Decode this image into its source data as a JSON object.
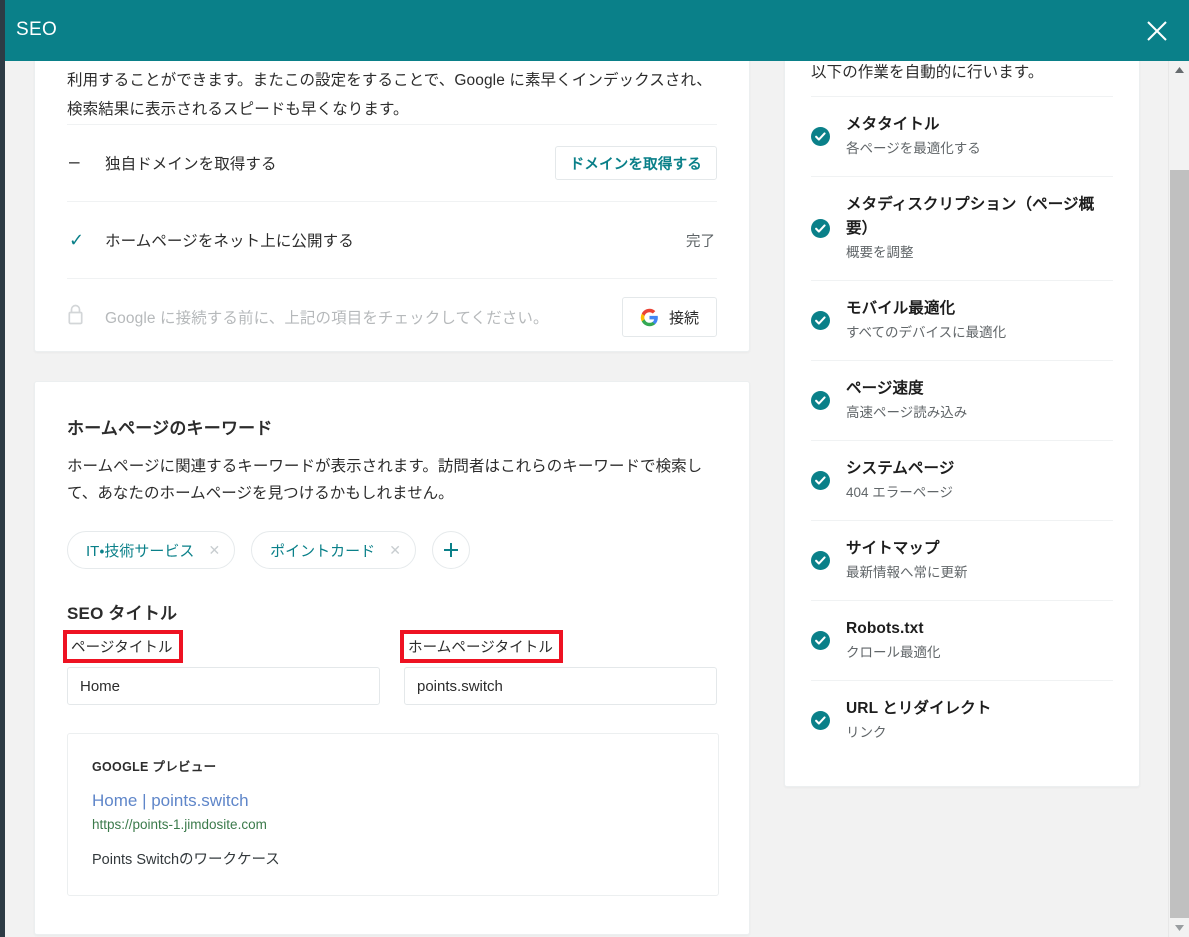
{
  "window": {
    "title": "SEO",
    "close_icon": "close-icon",
    "accent_color": "#0a8089",
    "annotation_color": "#ee1222"
  },
  "left_panel": {
    "intro_paragraph": "利用することができます。またこの設定をすることで、Google に素早くインデックスされ、検索結果に表示されるスピードも早くなります。",
    "tasks": [
      {
        "marker": "dash-icon",
        "marker_glyph": "–",
        "label": "独自ドメインを取得する",
        "action_label": "ドメインを取得する",
        "status": "",
        "disabled": false
      },
      {
        "marker": "check-icon",
        "marker_glyph": "✓",
        "label": "ホームページをネット上に公開する",
        "action_label": "",
        "status": "完了",
        "disabled": false
      },
      {
        "marker": "lock-icon",
        "marker_glyph": "",
        "label": "Google に接続する前に、上記の項目をチェックしてください。",
        "action_label": "接続",
        "action_icon": "google-g-icon",
        "status": "",
        "disabled": true
      }
    ],
    "keywords_section": {
      "heading": "ホームページのキーワード",
      "description": "ホームページに関連するキーワードが表示されます。訪問者はこれらのキーワードで検索して、あなたのホームページを見つけるかもしれません。",
      "chips": [
        {
          "label": "IT・技術サービス",
          "remove_icon": "close-small-icon"
        },
        {
          "label": "ポイントカード",
          "remove_icon": "close-small-icon"
        }
      ],
      "add_chip_icon": "plus-icon"
    },
    "seo_title_section": {
      "heading": "SEO タイトル",
      "fields": [
        {
          "label": "ページタイトル",
          "value": "Home",
          "placeholder": "ページタイトル",
          "annotated": true
        },
        {
          "label": "ホームページタイトル",
          "value": "points.switch",
          "placeholder": "ホームページタイトル",
          "annotated": true
        }
      ]
    },
    "google_preview": {
      "kicker": "GOOGLE プレビュー",
      "title": "Home | points.switch",
      "url": "https://points-1.jimdosite.com",
      "description": "Points Switchのワークケース",
      "title_color": "#5f86c9",
      "url_color": "#3b7a4b"
    }
  },
  "right_panel": {
    "intro": "以下の作業を自動的に行います。",
    "checklist": [
      {
        "title": "メタタイトル",
        "subtitle": "各ページを最適化する",
        "icon": "check-circle-icon"
      },
      {
        "title": "メタディスクリプション（ページ概要）",
        "subtitle": "概要を調整",
        "icon": "check-circle-icon"
      },
      {
        "title": "モバイル最適化",
        "subtitle": "すべてのデバイスに最適化",
        "icon": "check-circle-icon"
      },
      {
        "title": "ページ速度",
        "subtitle": "高速ページ読み込み",
        "icon": "check-circle-icon"
      },
      {
        "title": "システムページ",
        "subtitle": "404 エラーページ",
        "icon": "check-circle-icon"
      },
      {
        "title": "サイトマップ",
        "subtitle": "最新情報へ常に更新",
        "icon": "check-circle-icon"
      },
      {
        "title": "Robots.txt",
        "subtitle": "クロール最適化",
        "icon": "check-circle-icon"
      },
      {
        "title": "URL とリダイレクト",
        "subtitle": "リンク",
        "icon": "check-circle-icon"
      }
    ]
  },
  "scrollbar": {
    "up_icon": "triangle-up-icon",
    "down_icon": "triangle-down-icon"
  }
}
